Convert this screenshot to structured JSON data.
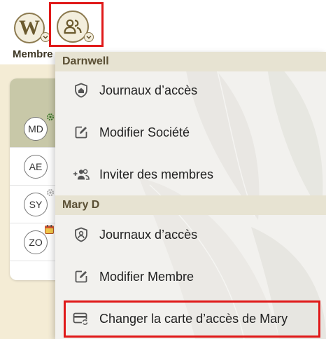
{
  "topbar": {
    "company_avatar_letter": "W",
    "members_label": "Membre"
  },
  "background_members": [
    {
      "initials": "MD",
      "badge": "gear-icon",
      "selected": true
    },
    {
      "initials": "AE",
      "badge": "",
      "selected": false
    },
    {
      "initials": "SY",
      "badge": "gear-icon",
      "selected": false
    },
    {
      "initials": "ZO",
      "badge": "calendar-icon",
      "selected": false
    }
  ],
  "menu": {
    "groups": [
      {
        "header": "Darnwell",
        "items": [
          {
            "label": "Journaux d’accès",
            "icon": "shield-home-icon"
          },
          {
            "label": "Modifier Société",
            "icon": "edit-icon"
          },
          {
            "label": "Inviter des membres",
            "icon": "add-users-icon"
          }
        ]
      },
      {
        "header": "Mary D",
        "items": [
          {
            "label": "Journaux d’accès",
            "icon": "shield-person-icon"
          },
          {
            "label": "Modifier Membre",
            "icon": "edit-icon"
          },
          {
            "label": "Changer la carte d’accès de Mary",
            "icon": "card-refresh-icon"
          }
        ]
      }
    ]
  },
  "colors": {
    "accent_border": "#8c7a4f",
    "avatar_bg": "#f3eedd",
    "group_header_bg": "#e7e3d2",
    "highlight": "#e01919"
  }
}
